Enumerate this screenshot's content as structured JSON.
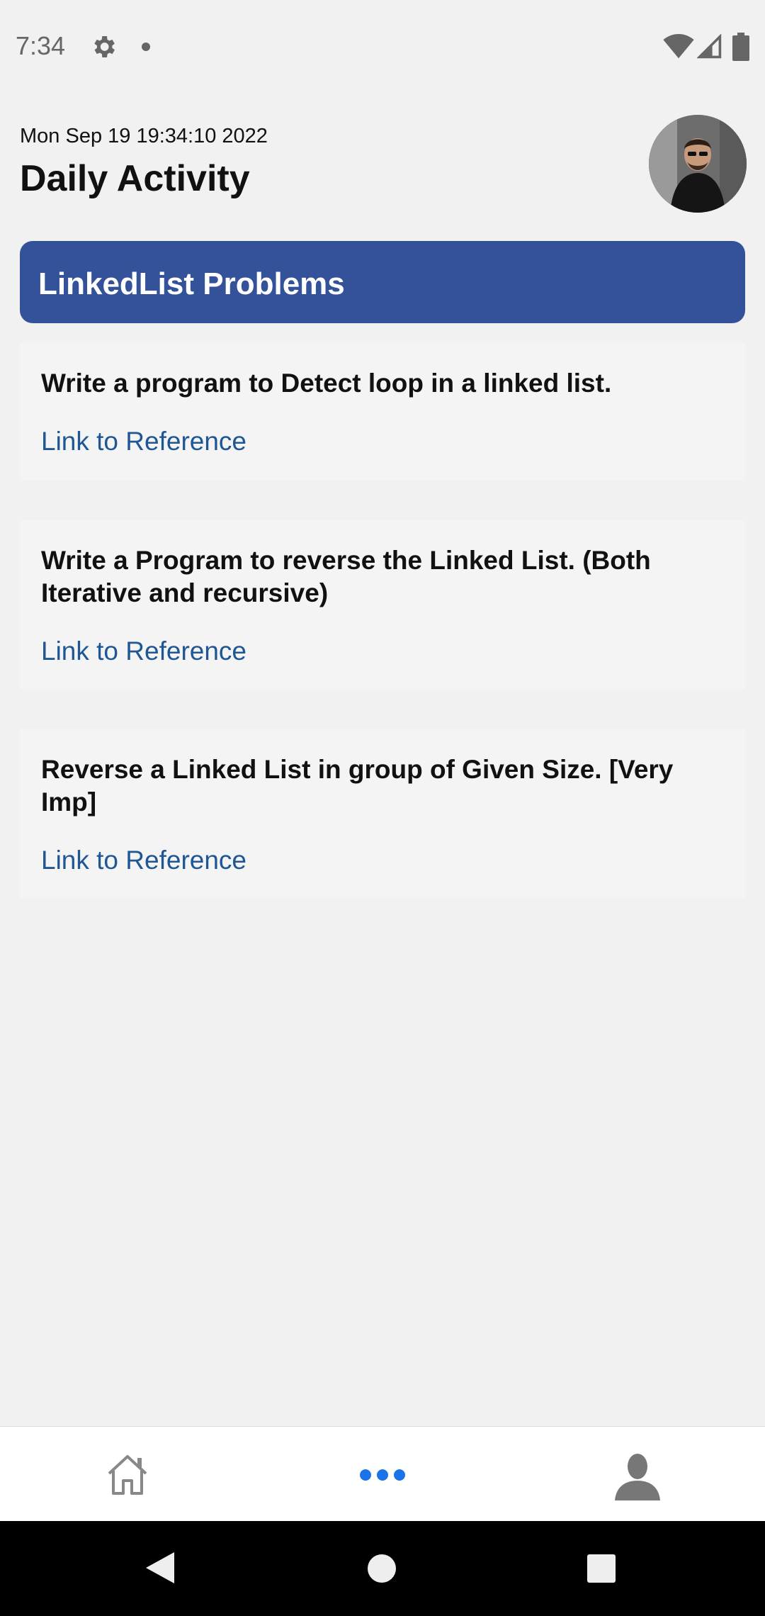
{
  "status_bar": {
    "time": "7:34",
    "icons": [
      "gear-icon",
      "notification-dot-icon",
      "wifi-icon",
      "signal-icon",
      "battery-icon"
    ]
  },
  "header": {
    "date": "Mon Sep 19 19:34:10 2022",
    "title": "Daily Activity",
    "avatar": "avatar-photo"
  },
  "category": {
    "title": "LinkedList Problems",
    "color": "#34529a"
  },
  "problems": [
    {
      "question": "Write a program to Detect loop in a linked list.",
      "link_label": "Link to Reference"
    },
    {
      "question": "Write a Program to reverse the Linked List. (Both Iterative and recursive)",
      "link_label": "Link to Reference"
    },
    {
      "question": "Reverse a Linked List in group of Given Size. [Very Imp]",
      "link_label": "Link to Reference"
    }
  ],
  "bottom_nav": {
    "items": [
      "home-icon",
      "more-icon",
      "profile-icon"
    ],
    "active_color": "#1a73e8"
  },
  "system_nav": {
    "items": [
      "back-icon",
      "home-circle-icon",
      "recents-icon"
    ]
  }
}
